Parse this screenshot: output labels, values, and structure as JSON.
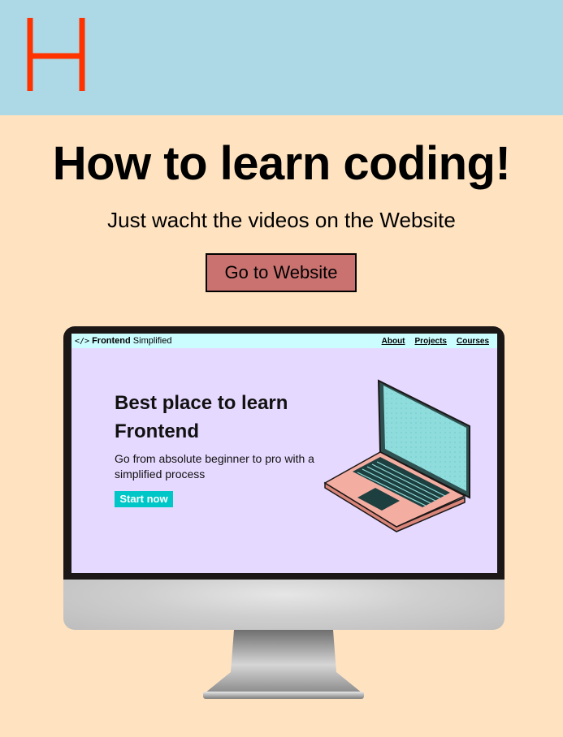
{
  "header": {
    "logo_letter": "H",
    "logo_color": "#ff3300",
    "background": "#add8e6"
  },
  "hero": {
    "title": "How to learn coding!",
    "subtitle": "Just wacht the videos on the Website",
    "button_label": "Go to Website",
    "button_color": "#c97270",
    "background": "#ffe3c1"
  },
  "monitor_screen": {
    "brand_icon": "</>",
    "brand_name": "Frontend",
    "brand_suffix": "Simplified",
    "nav_links": [
      "About",
      "Projects",
      "Courses"
    ],
    "headline": "Best place to learn Frontend",
    "description": "Go from absolute beginner to pro with a simplified process",
    "start_button_label": "Start now",
    "nav_background": "#cbfdff",
    "background": "#e6d9ff",
    "accent": "#00c7c7",
    "illustration_icon": "laptop-icon"
  }
}
